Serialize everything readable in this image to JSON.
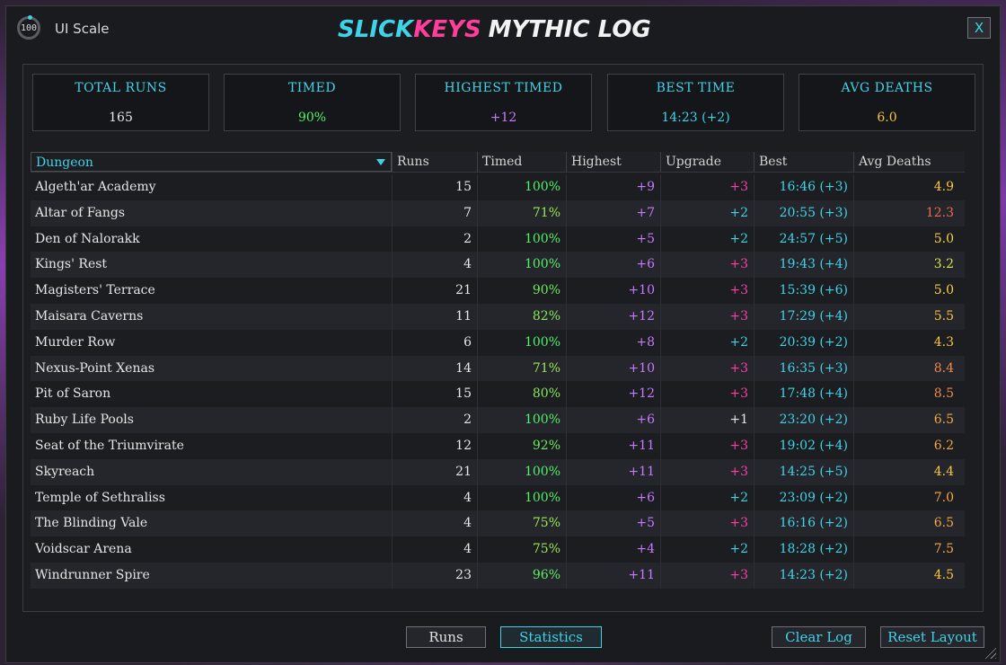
{
  "app": {
    "title_part1": "SLICK",
    "title_part2": "KEYS",
    "title_part3": "MYTHIC LOG",
    "close_label": "X"
  },
  "ui_scale": {
    "value": "100",
    "label": "UI Scale"
  },
  "stats": [
    {
      "label": "TOTAL RUNS",
      "value": "165",
      "color": "#e6e6e6"
    },
    {
      "label": "TIMED",
      "value": "90%",
      "color": "#52f06a"
    },
    {
      "label": "HIGHEST TIMED",
      "value": "+12",
      "color": "#c57bff"
    },
    {
      "label": "BEST TIME",
      "value": "14:23 (+2)",
      "color": "#3fd3e8"
    },
    {
      "label": "AVG DEATHS",
      "value": "6.0",
      "color": "#f5c542"
    }
  ],
  "table": {
    "columns": [
      "Dungeon",
      "Runs",
      "Timed",
      "Highest",
      "Upgrade",
      "Best",
      "Avg Deaths"
    ],
    "rows": [
      {
        "name": "Algeth'ar Academy",
        "runs": "15",
        "timed": "100%",
        "timed_color": "#52f06a",
        "highest": "+9",
        "upgrade": "+3",
        "upgrade_color": "#ff3da8",
        "best": "16:46 (+3)",
        "avg": "4.9",
        "avg_color": "#f5c542"
      },
      {
        "name": "Altar of Fangs",
        "runs": "7",
        "timed": "71%",
        "timed_color": "#9be657",
        "highest": "+7",
        "upgrade": "+2",
        "upgrade_color": "#3fd3e8",
        "best": "20:55 (+3)",
        "avg": "12.3",
        "avg_color": "#f06a4a"
      },
      {
        "name": "Den of Nalorakk",
        "runs": "2",
        "timed": "100%",
        "timed_color": "#52f06a",
        "highest": "+5",
        "upgrade": "+2",
        "upgrade_color": "#3fd3e8",
        "best": "24:57 (+5)",
        "avg": "5.0",
        "avg_color": "#f5d442"
      },
      {
        "name": "Kings' Rest",
        "runs": "4",
        "timed": "100%",
        "timed_color": "#52f06a",
        "highest": "+6",
        "upgrade": "+3",
        "upgrade_color": "#ff3da8",
        "best": "19:43 (+4)",
        "avg": "3.2",
        "avg_color": "#d7e64a"
      },
      {
        "name": "Magisters' Terrace",
        "runs": "21",
        "timed": "90%",
        "timed_color": "#6fea5e",
        "highest": "+10",
        "upgrade": "+3",
        "upgrade_color": "#ff3da8",
        "best": "15:39 (+6)",
        "avg": "5.0",
        "avg_color": "#f5d442"
      },
      {
        "name": "Maisara Caverns",
        "runs": "11",
        "timed": "82%",
        "timed_color": "#86e85a",
        "highest": "+12",
        "upgrade": "+3",
        "upgrade_color": "#ff3da8",
        "best": "17:29 (+4)",
        "avg": "5.5",
        "avg_color": "#f5c542"
      },
      {
        "name": "Murder Row",
        "runs": "6",
        "timed": "100%",
        "timed_color": "#52f06a",
        "highest": "+8",
        "upgrade": "+2",
        "upgrade_color": "#3fd3e8",
        "best": "20:39 (+2)",
        "avg": "4.3",
        "avg_color": "#f5c542"
      },
      {
        "name": "Nexus-Point Xenas",
        "runs": "14",
        "timed": "71%",
        "timed_color": "#9be657",
        "highest": "+10",
        "upgrade": "+3",
        "upgrade_color": "#ff3da8",
        "best": "16:35 (+3)",
        "avg": "8.4",
        "avg_color": "#f08a4a"
      },
      {
        "name": "Pit of Saron",
        "runs": "15",
        "timed": "80%",
        "timed_color": "#86e85a",
        "highest": "+12",
        "upgrade": "+3",
        "upgrade_color": "#ff3da8",
        "best": "17:48 (+4)",
        "avg": "8.5",
        "avg_color": "#f08a4a"
      },
      {
        "name": "Ruby Life Pools",
        "runs": "2",
        "timed": "100%",
        "timed_color": "#52f06a",
        "highest": "+6",
        "upgrade": "+1",
        "upgrade_color": "#e6e6e6",
        "best": "23:20 (+2)",
        "avg": "6.5",
        "avg_color": "#f5a742"
      },
      {
        "name": "Seat of the Triumvirate",
        "runs": "12",
        "timed": "92%",
        "timed_color": "#6fea5e",
        "highest": "+11",
        "upgrade": "+3",
        "upgrade_color": "#ff3da8",
        "best": "19:02 (+4)",
        "avg": "6.2",
        "avg_color": "#f5a742"
      },
      {
        "name": "Skyreach",
        "runs": "21",
        "timed": "100%",
        "timed_color": "#52f06a",
        "highest": "+11",
        "upgrade": "+3",
        "upgrade_color": "#ff3da8",
        "best": "14:25 (+5)",
        "avg": "4.4",
        "avg_color": "#f5c542"
      },
      {
        "name": "Temple of Sethraliss",
        "runs": "4",
        "timed": "100%",
        "timed_color": "#52f06a",
        "highest": "+6",
        "upgrade": "+2",
        "upgrade_color": "#3fd3e8",
        "best": "23:09 (+2)",
        "avg": "7.0",
        "avg_color": "#f5a742"
      },
      {
        "name": "The Blinding Vale",
        "runs": "4",
        "timed": "75%",
        "timed_color": "#9be657",
        "highest": "+5",
        "upgrade": "+3",
        "upgrade_color": "#ff3da8",
        "best": "16:16 (+2)",
        "avg": "6.5",
        "avg_color": "#f5a742"
      },
      {
        "name": "Voidscar Arena",
        "runs": "4",
        "timed": "75%",
        "timed_color": "#9be657",
        "highest": "+4",
        "upgrade": "+2",
        "upgrade_color": "#3fd3e8",
        "best": "18:28 (+2)",
        "avg": "7.5",
        "avg_color": "#f5a742"
      },
      {
        "name": "Windrunner Spire",
        "runs": "23",
        "timed": "96%",
        "timed_color": "#5eee64",
        "highest": "+11",
        "upgrade": "+3",
        "upgrade_color": "#ff3da8",
        "best": "14:23 (+2)",
        "avg": "4.5",
        "avg_color": "#f5c542"
      }
    ]
  },
  "buttons": {
    "runs": "Runs",
    "statistics": "Statistics",
    "clear_log": "Clear Log",
    "reset_layout": "Reset Layout"
  }
}
